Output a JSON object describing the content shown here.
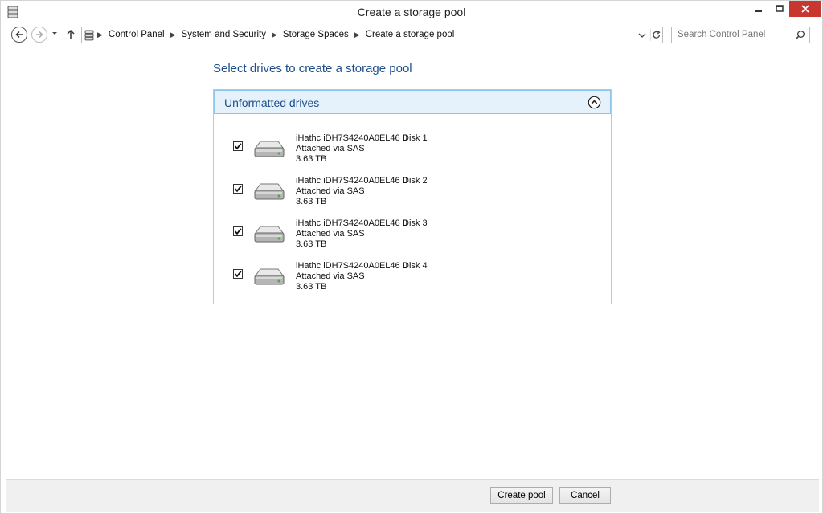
{
  "window": {
    "title": "Create a storage pool"
  },
  "nav": {
    "breadcrumb": [
      "Control Panel",
      "System and Security",
      "Storage Spaces",
      "Create a storage pool"
    ],
    "search_placeholder": "Search Control Panel"
  },
  "main": {
    "heading": "Select drives to create a storage pool",
    "section_title": "Unformatted drives",
    "drives": [
      {
        "checked": true,
        "name": "iHathc iDH7S4240A0EL46 0",
        "disk": "Disk 1",
        "connection": "Attached via SAS",
        "size": "3.63 TB"
      },
      {
        "checked": true,
        "name": "iHathc iDH7S4240A0EL46 0",
        "disk": "Disk 2",
        "connection": "Attached via SAS",
        "size": "3.63 TB"
      },
      {
        "checked": true,
        "name": "iHathc iDH7S4240A0EL46 0",
        "disk": "Disk 3",
        "connection": "Attached via SAS",
        "size": "3.63 TB"
      },
      {
        "checked": true,
        "name": "iHathc iDH7S4240A0EL46 0",
        "disk": "Disk 4",
        "connection": "Attached via SAS",
        "size": "3.63 TB"
      }
    ]
  },
  "footer": {
    "create_label": "Create pool",
    "cancel_label": "Cancel"
  },
  "colors": {
    "accent": "#1e4e8c",
    "header_bg": "#e5f1fb",
    "close": "#c7372f"
  }
}
